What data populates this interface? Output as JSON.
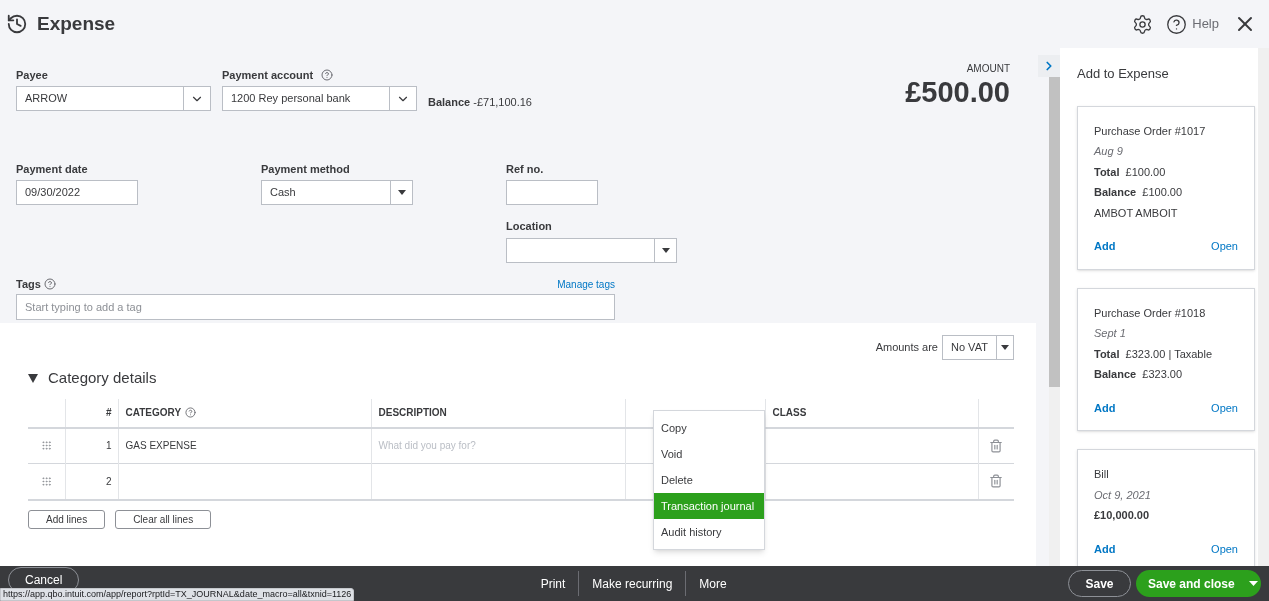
{
  "header": {
    "title": "Expense",
    "help_label": "Help"
  },
  "form": {
    "payee": {
      "label": "Payee",
      "value": "ARROW"
    },
    "payment_account": {
      "label": "Payment account",
      "value": "1200 Rey personal bank"
    },
    "balance": {
      "label": "Balance",
      "value": "-£71,100.16"
    },
    "amount": {
      "label": "AMOUNT",
      "value": "£500.00"
    },
    "payment_date": {
      "label": "Payment date",
      "value": "09/30/2022"
    },
    "payment_method": {
      "label": "Payment method",
      "value": "Cash"
    },
    "ref_no": {
      "label": "Ref no."
    },
    "location": {
      "label": "Location"
    },
    "tags": {
      "label": "Tags",
      "placeholder": "Start typing to add a tag",
      "manage_link": "Manage tags"
    }
  },
  "amounts_are": {
    "label": "Amounts are",
    "value": "No VAT"
  },
  "category_details": {
    "title": "Category details",
    "expanded": true,
    "columns": [
      "#",
      "CATEGORY",
      "DESCRIPTION",
      "CLASS"
    ],
    "rows": [
      {
        "number": "1",
        "category": "GAS EXPENSE",
        "description_placeholder": "What did you pay for?"
      },
      {
        "number": "2",
        "category": ""
      }
    ],
    "buttons": [
      "Add lines",
      "Clear all lines"
    ]
  },
  "more_menu": [
    {
      "label": "Copy",
      "selected": false
    },
    {
      "label": "Void",
      "selected": false
    },
    {
      "label": "Delete",
      "selected": false
    },
    {
      "label": "Transaction journal",
      "selected": true
    },
    {
      "label": "Audit history",
      "selected": false
    }
  ],
  "side_panel": {
    "title": "Add to Expense",
    "cards": [
      {
        "title": "Purchase Order #1017",
        "date": "Aug 9",
        "lines": [
          {
            "label": "Total",
            "value": "£100.00"
          },
          {
            "label": "Balance",
            "value": "£100.00"
          }
        ],
        "note": "AMBOT AMBOIT",
        "add": "Add",
        "open": "Open"
      },
      {
        "title": "Purchase Order #1018",
        "date": "Sept 1",
        "lines": [
          {
            "label": "Total",
            "value": "£323.00 | Taxable"
          },
          {
            "label": "Balance",
            "value": "£323.00"
          }
        ],
        "add": "Add",
        "open": "Open"
      },
      {
        "title": "Bill",
        "date": "Oct 9, 2021",
        "amount": "£10,000.00",
        "add": "Add",
        "open": "Open"
      }
    ]
  },
  "footer": {
    "cancel": "Cancel",
    "actions": [
      "Print",
      "Make recurring",
      "More"
    ],
    "save": "Save",
    "save_and_close": "Save and close"
  },
  "status_url": "https://app.qbo.intuit.com/app/report?rptId=TX_JOURNAL&date_macro=all&txnid=1126"
}
